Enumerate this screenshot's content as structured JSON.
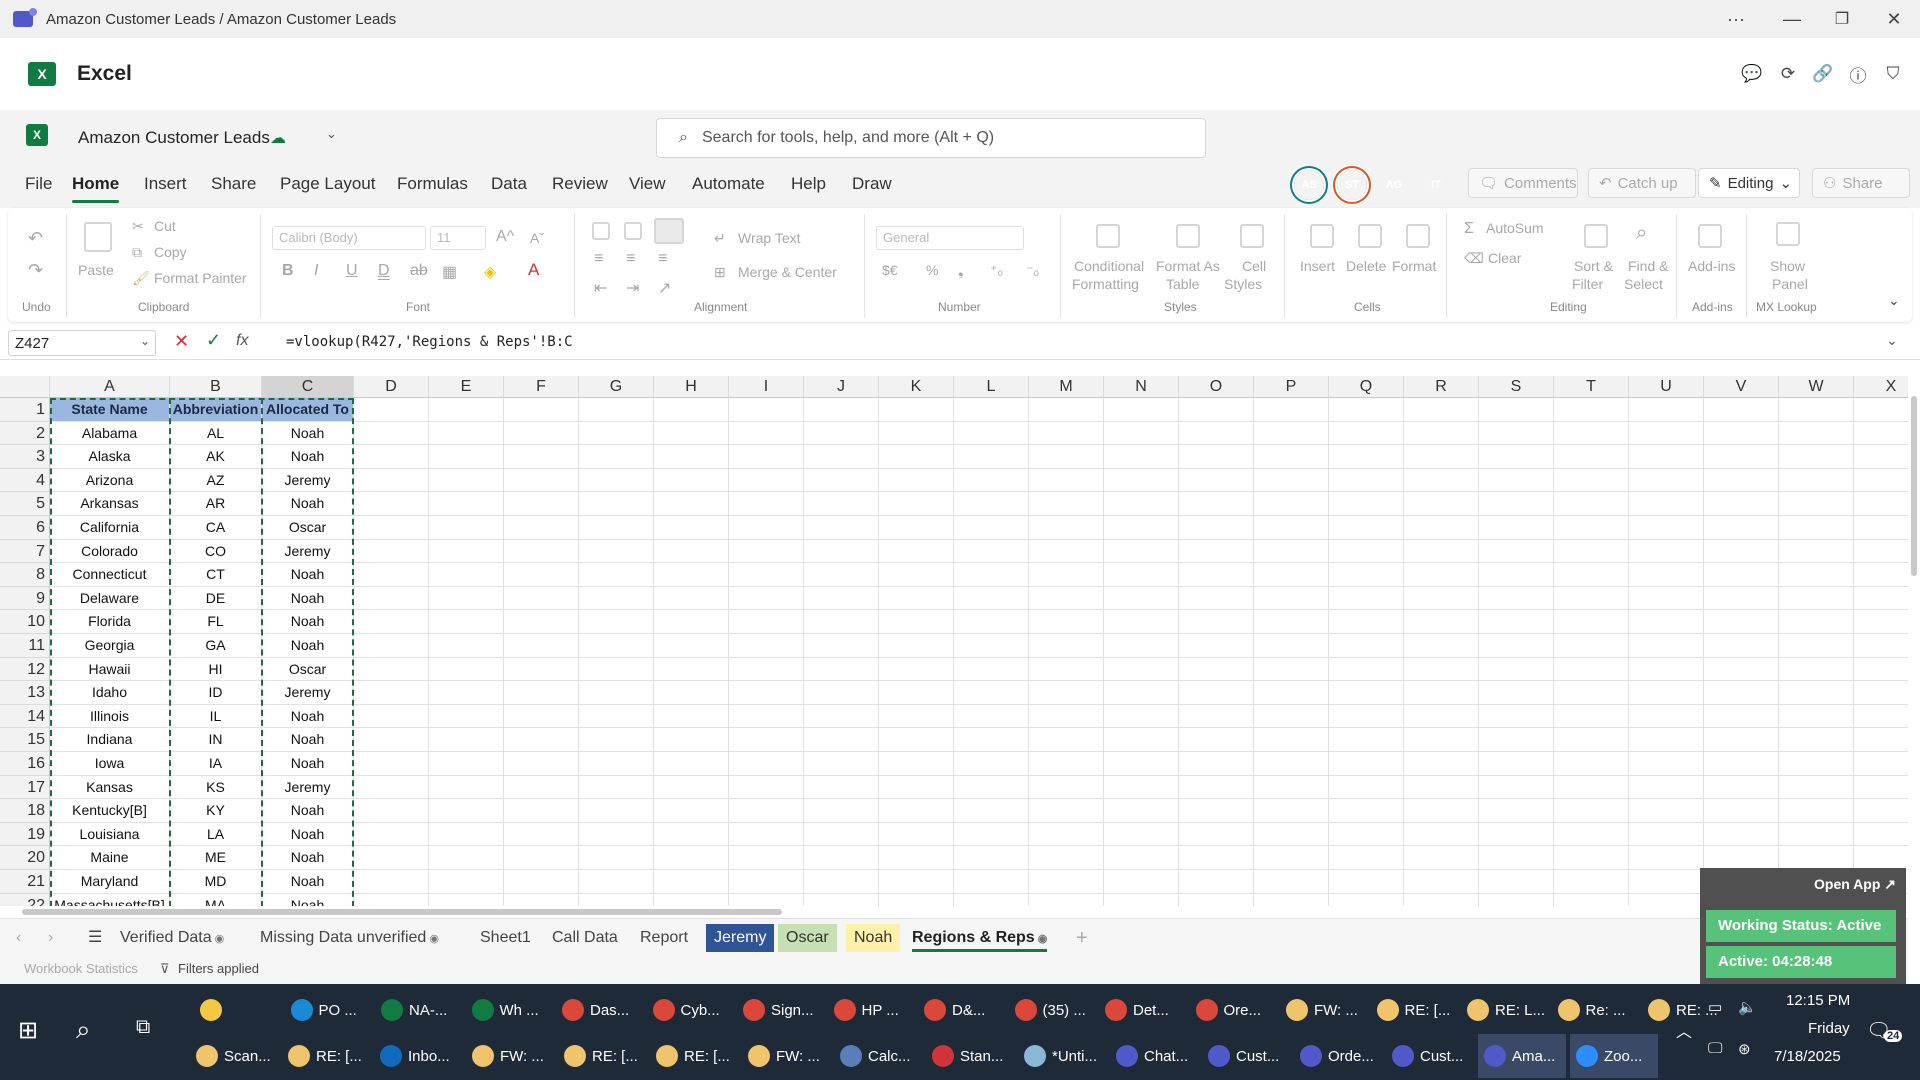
{
  "window": {
    "title": "Amazon Customer Leads / Amazon Customer Leads",
    "more": "···",
    "minimize": "—",
    "maximize": "❐",
    "close": "✕"
  },
  "app": {
    "name": "Excel",
    "logo": "X"
  },
  "doc": {
    "name": "Amazon Customer Leads",
    "search_placeholder": "Search for tools, help, and more (Alt + Q)"
  },
  "menu": {
    "tabs": [
      "File",
      "Home",
      "Insert",
      "Share",
      "Page Layout",
      "Formulas",
      "Data",
      "Review",
      "View",
      "Automate",
      "Help",
      "Draw"
    ],
    "active_tab": "Home",
    "avatars": [
      {
        "initials": "AS",
        "color": "#0f7b8c"
      },
      {
        "initials": "ST",
        "color": "#d65a23"
      },
      {
        "initials": "AG",
        "color": "#d13438"
      },
      {
        "initials": "IT",
        "color": "#c239b3"
      }
    ],
    "comments": "Comments",
    "catch_up": "Catch up",
    "editing": "Editing",
    "share": "Share"
  },
  "ribbon": {
    "undo_label": "Undo",
    "clipboard": {
      "paste": "Paste",
      "cut": "Cut",
      "copy": "Copy",
      "format_painter": "Format Painter",
      "label": "Clipboard"
    },
    "font": {
      "name": "Calibri (Body)",
      "size": "11",
      "label": "Font"
    },
    "alignment": {
      "wrap": "Wrap Text",
      "merge": "Merge & Center",
      "label": "Alignment"
    },
    "number": {
      "format": "General",
      "label": "Number"
    },
    "styles": {
      "conditional": "Conditional",
      "formatting": "Formatting",
      "format_as": "Format As",
      "table": "Table",
      "cell": "Cell",
      "cell_styles": "Styles",
      "label": "Styles"
    },
    "cells": {
      "insert": "Insert",
      "delete": "Delete",
      "format": "Format",
      "label": "Cells"
    },
    "editing": {
      "autosum": "AutoSum",
      "clear": "Clear",
      "sort": "Sort &",
      "filter": "Filter",
      "find": "Find &",
      "select": "Select",
      "label": "Editing"
    },
    "addins": {
      "addins": "Add-ins",
      "label": "Add-ins"
    },
    "mx": {
      "show": "Show",
      "panel": "Panel",
      "label": "MX Lookup"
    }
  },
  "formula_bar": {
    "name_box": "Z427",
    "formula": "=vlookup(R427,'Regions & Reps'!B:C"
  },
  "grid": {
    "columns": [
      "A",
      "B",
      "C",
      "D",
      "E",
      "F",
      "G",
      "H",
      "I",
      "J",
      "K",
      "L",
      "M",
      "N",
      "O",
      "P",
      "Q",
      "R",
      "S",
      "T",
      "U",
      "V",
      "W",
      "X"
    ],
    "header": [
      "State Name",
      "Abbreviation",
      "Allocated To"
    ],
    "rows": [
      [
        "Alabama",
        "AL",
        "Noah"
      ],
      [
        "Alaska",
        "AK",
        "Noah"
      ],
      [
        "Arizona",
        "AZ",
        "Jeremy"
      ],
      [
        "Arkansas",
        "AR",
        "Noah"
      ],
      [
        "California",
        "CA",
        "Oscar"
      ],
      [
        "Colorado",
        "CO",
        "Jeremy"
      ],
      [
        "Connecticut",
        "CT",
        "Noah"
      ],
      [
        "Delaware",
        "DE",
        "Noah"
      ],
      [
        "Florida",
        "FL",
        "Noah"
      ],
      [
        "Georgia",
        "GA",
        "Noah"
      ],
      [
        "Hawaii",
        "HI",
        "Oscar"
      ],
      [
        "Idaho",
        "ID",
        "Jeremy"
      ],
      [
        "Illinois",
        "IL",
        "Noah"
      ],
      [
        "Indiana",
        "IN",
        "Noah"
      ],
      [
        "Iowa",
        "IA",
        "Noah"
      ],
      [
        "Kansas",
        "KS",
        "Jeremy"
      ],
      [
        "Kentucky[B]",
        "KY",
        "Noah"
      ],
      [
        "Louisiana",
        "LA",
        "Noah"
      ],
      [
        "Maine",
        "ME",
        "Noah"
      ],
      [
        "Maryland",
        "MD",
        "Noah"
      ],
      [
        "Massachusetts[B]",
        "MA",
        "Noah"
      ]
    ]
  },
  "sheets": [
    {
      "name": "Verified Data",
      "color": "",
      "icon": true
    },
    {
      "name": "Missing Data unverified",
      "color": "",
      "icon": true
    },
    {
      "name": "Sheet1",
      "color": ""
    },
    {
      "name": "Call Data",
      "color": ""
    },
    {
      "name": "Report",
      "color": ""
    },
    {
      "name": "Jeremy",
      "color": "#2f5597"
    },
    {
      "name": "Oscar",
      "color": "#c6e0b4"
    },
    {
      "name": "Noah",
      "color": "#fff2a8"
    },
    {
      "name": "Regions & Reps",
      "color": "",
      "icon": true,
      "active": true
    }
  ],
  "status": {
    "workbook_stats": "Workbook Statistics",
    "filters": "Filters applied"
  },
  "widget": {
    "open_app": "Open App ↗",
    "working_status": "Working Status: Active",
    "active_time": "Active: 04:28:48"
  },
  "taskbar": {
    "row1": [
      {
        "label": "",
        "color": "#f4c842"
      },
      {
        "label": "PO ...",
        "color": "#1b8ad6"
      },
      {
        "label": "NA-...",
        "color": "#107c41"
      },
      {
        "label": "Wh ...",
        "color": "#107c41"
      },
      {
        "label": "Das...",
        "color": "#d94838"
      },
      {
        "label": "Cyb...",
        "color": "#d94838"
      },
      {
        "label": "Sign...",
        "color": "#d94838"
      },
      {
        "label": "HP ...",
        "color": "#d94838"
      },
      {
        "label": "D&...",
        "color": "#d94838"
      },
      {
        "label": "(35) ...",
        "color": "#d94838"
      },
      {
        "label": "Det...",
        "color": "#d94838"
      },
      {
        "label": "Ore...",
        "color": "#d94838"
      },
      {
        "label": "FW: ...",
        "color": "#f0c36d"
      },
      {
        "label": "RE: [...",
        "color": "#f0c36d"
      },
      {
        "label": "RE: L...",
        "color": "#f0c36d"
      },
      {
        "label": "Re: ...",
        "color": "#f0c36d"
      },
      {
        "label": "RE: ...",
        "color": "#f0c36d"
      }
    ],
    "row2": [
      {
        "label": "Scan...",
        "color": "#f0c36d"
      },
      {
        "label": "RE: [...",
        "color": "#f0c36d"
      },
      {
        "label": "Inbo...",
        "color": "#0f6cbd"
      },
      {
        "label": "FW: ...",
        "color": "#f0c36d"
      },
      {
        "label": "RE: [...",
        "color": "#f0c36d"
      },
      {
        "label": "RE: [...",
        "color": "#f0c36d"
      },
      {
        "label": "FW: ...",
        "color": "#f0c36d"
      },
      {
        "label": "Calc...",
        "color": "#5a7fb8"
      },
      {
        "label": "Stan...",
        "color": "#d13438"
      },
      {
        "label": "*Unti...",
        "color": "#8bb7d9"
      },
      {
        "label": "Chat...",
        "color": "#5059c9"
      },
      {
        "label": "Cust...",
        "color": "#5059c9"
      },
      {
        "label": "Orde...",
        "color": "#5059c9"
      },
      {
        "label": "Cust...",
        "color": "#5059c9"
      },
      {
        "label": "Ama...",
        "color": "#5059c9",
        "active": true
      },
      {
        "label": "Zoo...",
        "color": "#2d8cff",
        "active": true
      }
    ],
    "time": "12:15 PM",
    "day": "Friday",
    "date": "7/18/2025",
    "notif": "24"
  }
}
